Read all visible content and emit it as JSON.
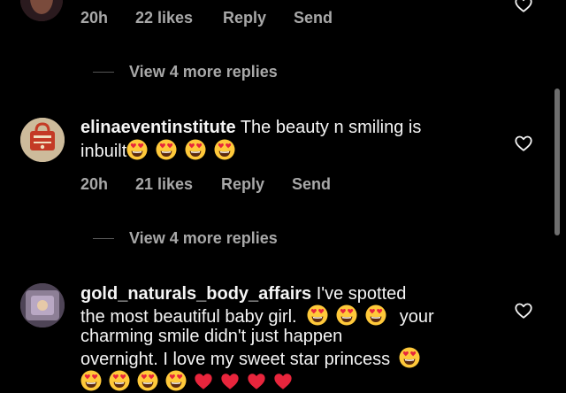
{
  "comments": [
    {
      "time": "20h",
      "likes": "22 likes",
      "reply": "Reply",
      "send": "Send",
      "view_replies": "View 4 more replies"
    },
    {
      "username": "elinaeventinstitute",
      "text_line1": "The beauty n smiling is",
      "text_line2": "inbuilt",
      "time": "20h",
      "likes": "21 likes",
      "reply": "Reply",
      "send": "Send",
      "view_replies": "View 4 more replies"
    },
    {
      "username": "gold_naturals_body_affairs",
      "text_line1": "I've spotted",
      "text_line2a": "the most beautiful baby girl.",
      "text_line2b": "your",
      "text_line3": "charming smile didn't just happen",
      "text_line4": "overnight. I love my sweet star princess"
    }
  ],
  "colors": {
    "background": "#000000",
    "text": "#f5f5f5",
    "meta": "#a8a8a8",
    "emoji_face": "#ffc93a",
    "emoji_heart": "#e8253c"
  },
  "icons": {
    "like": "heart-outline-icon",
    "emoji": "smiling-face-with-heart-eyes-icon",
    "red_heart": "red-heart-icon"
  }
}
